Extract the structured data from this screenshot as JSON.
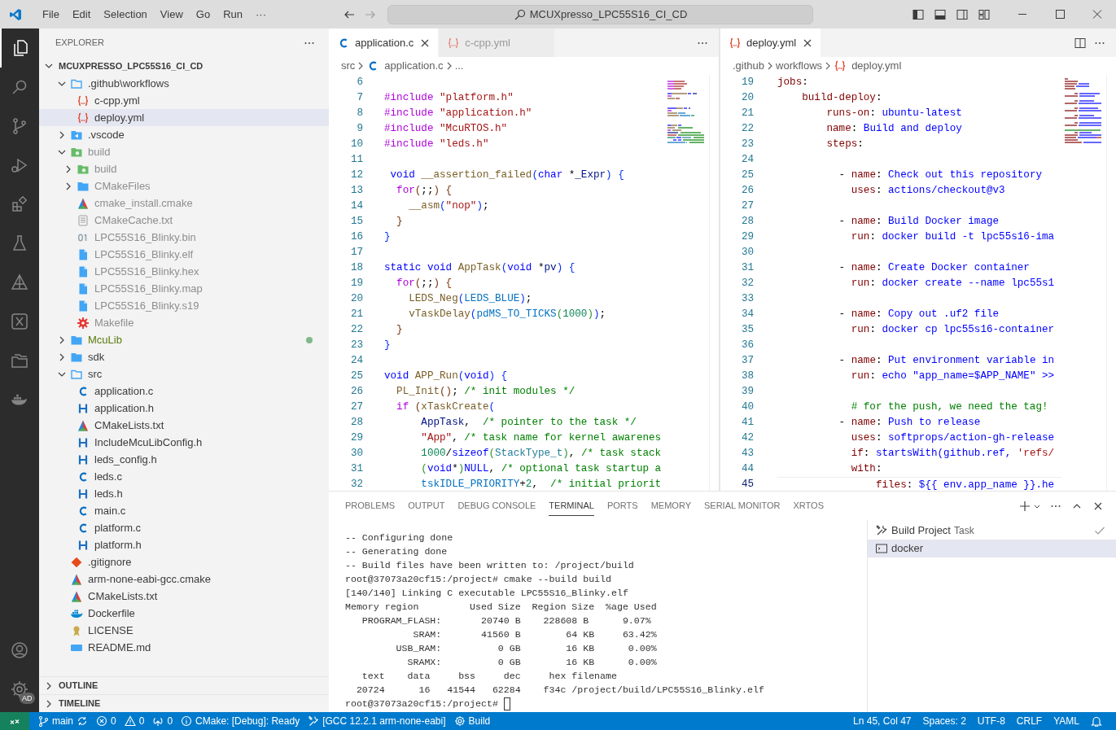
{
  "title_bar": {
    "menu": [
      "File",
      "Edit",
      "Selection",
      "View",
      "Go",
      "Run",
      "···"
    ],
    "search": "MCUXpresso_LPC55S16_CI_CD"
  },
  "activity_bar": {
    "items": [
      {
        "kind": "files",
        "selected": true
      },
      {
        "kind": "search",
        "selected": false
      },
      {
        "kind": "scm",
        "selected": false
      },
      {
        "kind": "debug",
        "selected": false
      },
      {
        "kind": "extensions",
        "selected": false
      },
      {
        "kind": "testing",
        "selected": false
      },
      {
        "kind": "triangle",
        "selected": false
      },
      {
        "kind": "xbox",
        "selected": false
      },
      {
        "kind": "folders",
        "selected": false
      },
      {
        "kind": "docker",
        "selected": false
      }
    ],
    "settings_badge": "AD"
  },
  "explorer": {
    "header": "EXPLORER",
    "root": "MCUXPRESSO_LPC55S16_CI_CD",
    "items": [
      {
        "label": ".github\\workflows",
        "kind": "folder_open",
        "expanded": true,
        "selected": false,
        "ignored": false,
        "children": [
          {
            "label": "c-cpp.yml",
            "kind": "yml",
            "selected": false,
            "ignored": false
          },
          {
            "label": "deploy.yml",
            "kind": "yml",
            "selected": true,
            "ignored": false
          }
        ]
      },
      {
        "label": ".vscode",
        "kind": "folder_vscode",
        "expanded": false,
        "selected": false,
        "ignored": false
      },
      {
        "label": "build",
        "kind": "folder_build",
        "expanded": true,
        "selected": false,
        "ignored": true,
        "children": [
          {
            "label": "build",
            "kind": "folder_build",
            "expanded": false,
            "selected": false,
            "ignored": true
          },
          {
            "label": "CMakeFiles",
            "kind": "folder",
            "expanded": false,
            "selected": false,
            "ignored": true
          },
          {
            "label": "cmake_install.cmake",
            "kind": "cmake",
            "selected": false,
            "ignored": true
          },
          {
            "label": "CMakeCache.txt",
            "kind": "txt",
            "selected": false,
            "ignored": true
          },
          {
            "label": "LPC55S16_Blinky.bin",
            "kind": "bin",
            "selected": false,
            "ignored": true
          },
          {
            "label": "LPC55S16_Blinky.elf",
            "kind": "file",
            "selected": false,
            "ignored": true
          },
          {
            "label": "LPC55S16_Blinky.hex",
            "kind": "file",
            "selected": false,
            "ignored": true
          },
          {
            "label": "LPC55S16_Blinky.map",
            "kind": "file",
            "selected": false,
            "ignored": true
          },
          {
            "label": "LPC55S16_Blinky.s19",
            "kind": "file",
            "selected": false,
            "ignored": true
          },
          {
            "label": "Makefile",
            "kind": "gear",
            "selected": false,
            "ignored": true
          }
        ]
      },
      {
        "label": "McuLib",
        "kind": "folder",
        "expanded": false,
        "selected": false,
        "ignored": false,
        "modified": true
      },
      {
        "label": "sdk",
        "kind": "folder",
        "expanded": false,
        "selected": false,
        "ignored": false
      },
      {
        "label": "src",
        "kind": "folder_open",
        "expanded": true,
        "selected": false,
        "ignored": false,
        "children": [
          {
            "label": "application.c",
            "kind": "c",
            "selected": false,
            "ignored": false
          },
          {
            "label": "application.h",
            "kind": "h",
            "selected": false,
            "ignored": false
          },
          {
            "label": "CMakeLists.txt",
            "kind": "cmake",
            "selected": false,
            "ignored": false
          },
          {
            "label": "IncludeMcuLibConfig.h",
            "kind": "h",
            "selected": false,
            "ignored": false
          },
          {
            "label": "leds_config.h",
            "kind": "h",
            "selected": false,
            "ignored": false
          },
          {
            "label": "leds.c",
            "kind": "c",
            "selected": false,
            "ignored": false
          },
          {
            "label": "leds.h",
            "kind": "h",
            "selected": false,
            "ignored": false
          },
          {
            "label": "main.c",
            "kind": "c",
            "selected": false,
            "ignored": false
          },
          {
            "label": "platform.c",
            "kind": "c",
            "selected": false,
            "ignored": false
          },
          {
            "label": "platform.h",
            "kind": "h",
            "selected": false,
            "ignored": false
          }
        ]
      },
      {
        "label": ".gitignore",
        "kind": "git",
        "selected": false,
        "ignored": false
      },
      {
        "label": "arm-none-eabi-gcc.cmake",
        "kind": "cmake",
        "selected": false,
        "ignored": false
      },
      {
        "label": "CMakeLists.txt",
        "kind": "cmake",
        "selected": false,
        "ignored": false
      },
      {
        "label": "Dockerfile",
        "kind": "docker",
        "selected": false,
        "ignored": false
      },
      {
        "label": "LICENSE",
        "kind": "license",
        "selected": false,
        "ignored": false
      },
      {
        "label": "README.md",
        "kind": "md",
        "selected": false,
        "ignored": false
      }
    ],
    "sections": [
      {
        "label": "OUTLINE",
        "expanded": false
      },
      {
        "label": "TIMELINE",
        "expanded": false
      }
    ]
  },
  "editor_groups": [
    {
      "tabs": [
        {
          "label": "application.c",
          "kind": "c",
          "selected": true
        },
        {
          "label": "c-cpp.yml",
          "kind": "yml",
          "selected": false
        }
      ],
      "breadcrumbs": [
        {
          "label": "src"
        },
        {
          "label": "application.c",
          "kind": "c"
        },
        {
          "label": "..."
        }
      ],
      "lines": [
        {
          "n": "6"
        },
        {
          "n": "7",
          "code": [
            {
              "text": "#include",
              "kind": "pp"
            },
            {
              "text": " \"platform.h\"",
              "kind": "str"
            }
          ]
        },
        {
          "n": "8",
          "code": [
            {
              "text": "#include",
              "kind": "pp"
            },
            {
              "text": " \"application.h\"",
              "kind": "str"
            }
          ]
        },
        {
          "n": "9",
          "code": [
            {
              "text": "#include",
              "kind": "pp"
            },
            {
              "text": " \"McuRTOS.h\"",
              "kind": "str"
            }
          ]
        },
        {
          "n": "10",
          "code": [
            {
              "text": "#include",
              "kind": "pp"
            },
            {
              "text": " \"leds.h\"",
              "kind": "str"
            }
          ]
        },
        {
          "n": "11"
        },
        {
          "n": "12",
          "code": [
            {
              "text": " void",
              "kind": "kw"
            },
            {
              "text": " __assertion_failed",
              "kind": "fn"
            },
            {
              "text": "(",
              "kind": "b1"
            },
            {
              "text": "char",
              "kind": "kw"
            },
            {
              "text": " *",
              "kind": "plain"
            },
            {
              "text": "_Expr",
              "kind": "var"
            },
            {
              "text": ")",
              "kind": "b1"
            },
            {
              "text": " {",
              "kind": "b1"
            }
          ]
        },
        {
          "n": "13",
          "code": [
            {
              "text": "  for",
              "kind": "ctl"
            },
            {
              "text": "(",
              "kind": "b3"
            },
            {
              "text": ";;",
              "kind": "plain"
            },
            {
              "text": ")",
              "kind": "b3"
            },
            {
              "text": " {",
              "kind": "b3"
            }
          ]
        },
        {
          "n": "14",
          "code": [
            {
              "text": "    __asm",
              "kind": "fn"
            },
            {
              "text": "(",
              "kind": "b1"
            },
            {
              "text": "\"nop\"",
              "kind": "str"
            },
            {
              "text": ")",
              "kind": "b1"
            },
            {
              "text": ";",
              "kind": "plain"
            }
          ]
        },
        {
          "n": "15",
          "code": [
            {
              "text": "  }",
              "kind": "b3"
            }
          ]
        },
        {
          "n": "16",
          "code": [
            {
              "text": "}",
              "kind": "b1"
            }
          ]
        },
        {
          "n": "17"
        },
        {
          "n": "18",
          "code": [
            {
              "text": "static",
              "kind": "kw"
            },
            {
              "text": " void",
              "kind": "kw"
            },
            {
              "text": " AppTask",
              "kind": "fn"
            },
            {
              "text": "(",
              "kind": "b1"
            },
            {
              "text": "void",
              "kind": "kw"
            },
            {
              "text": " *",
              "kind": "plain"
            },
            {
              "text": "pv",
              "kind": "var"
            },
            {
              "text": ")",
              "kind": "b1"
            },
            {
              "text": " {",
              "kind": "b1"
            }
          ]
        },
        {
          "n": "19",
          "code": [
            {
              "text": "  for",
              "kind": "ctl"
            },
            {
              "text": "(",
              "kind": "b3"
            },
            {
              "text": ";;",
              "kind": "plain"
            },
            {
              "text": ")",
              "kind": "b3"
            },
            {
              "text": " {",
              "kind": "b3"
            }
          ]
        },
        {
          "n": "20",
          "code": [
            {
              "text": "    LEDS_Neg",
              "kind": "fn"
            },
            {
              "text": "(",
              "kind": "b1"
            },
            {
              "text": "LEDS_BLUE",
              "kind": "const"
            },
            {
              "text": ")",
              "kind": "b1"
            },
            {
              "text": ";",
              "kind": "plain"
            }
          ]
        },
        {
          "n": "21",
          "code": [
            {
              "text": "    vTaskDelay",
              "kind": "fn"
            },
            {
              "text": "(",
              "kind": "b1"
            },
            {
              "text": "pdMS_TO_TICKS",
              "kind": "const"
            },
            {
              "text": "(",
              "kind": "b2"
            },
            {
              "text": "1000",
              "kind": "num"
            },
            {
              "text": ")",
              "kind": "b2"
            },
            {
              "text": ")",
              "kind": "b1"
            },
            {
              "text": ";",
              "kind": "plain"
            }
          ]
        },
        {
          "n": "22",
          "code": [
            {
              "text": "  }",
              "kind": "b3"
            }
          ]
        },
        {
          "n": "23",
          "code": [
            {
              "text": "}",
              "kind": "b1"
            }
          ]
        },
        {
          "n": "24"
        },
        {
          "n": "25",
          "code": [
            {
              "text": "void",
              "kind": "kw"
            },
            {
              "text": " APP_Run",
              "kind": "fn"
            },
            {
              "text": "(",
              "kind": "b1"
            },
            {
              "text": "void",
              "kind": "kw"
            },
            {
              "text": ")",
              "kind": "b1"
            },
            {
              "text": " {",
              "kind": "b1"
            }
          ]
        },
        {
          "n": "26",
          "code": [
            {
              "text": "  PL_Init",
              "kind": "fn"
            },
            {
              "text": "(",
              "kind": "b3"
            },
            {
              "text": ")",
              "kind": "b3"
            },
            {
              "text": "; ",
              "kind": "plain"
            },
            {
              "text": "/* init modules */",
              "kind": "cm"
            }
          ]
        },
        {
          "n": "27",
          "code": [
            {
              "text": "  if",
              "kind": "ctl"
            },
            {
              "text": " (",
              "kind": "b3"
            },
            {
              "text": "xTaskCreate",
              "kind": "fn"
            },
            {
              "text": "(",
              "kind": "b1"
            }
          ]
        },
        {
          "n": "28",
          "code": [
            {
              "text": "      AppTask",
              "kind": "var"
            },
            {
              "text": ",  ",
              "kind": "plain"
            },
            {
              "text": "/* pointer to the task */",
              "kind": "cm"
            }
          ]
        },
        {
          "n": "29",
          "code": [
            {
              "text": "      \"App\"",
              "kind": "str"
            },
            {
              "text": ", ",
              "kind": "plain"
            },
            {
              "text": "/* task name for kernel awarenes",
              "kind": "cm"
            }
          ]
        },
        {
          "n": "30",
          "code": [
            {
              "text": "      1000",
              "kind": "num"
            },
            {
              "text": "/",
              "kind": "plain"
            },
            {
              "text": "sizeof",
              "kind": "kw"
            },
            {
              "text": "(",
              "kind": "b2"
            },
            {
              "text": "StackType_t",
              "kind": "type"
            },
            {
              "text": ")",
              "kind": "b2"
            },
            {
              "text": ", ",
              "kind": "plain"
            },
            {
              "text": "/* task stack",
              "kind": "cm"
            }
          ]
        },
        {
          "n": "31",
          "code": [
            {
              "text": "      (",
              "kind": "b2"
            },
            {
              "text": "void",
              "kind": "kw"
            },
            {
              "text": "*",
              "kind": "plain"
            },
            {
              "text": ")",
              "kind": "b2"
            },
            {
              "text": "NULL",
              "kind": "kw"
            },
            {
              "text": ", ",
              "kind": "plain"
            },
            {
              "text": "/* optional task startup a",
              "kind": "cm"
            }
          ]
        },
        {
          "n": "32",
          "code": [
            {
              "text": "      tskIDLE_PRIORITY",
              "kind": "const"
            },
            {
              "text": "+",
              "kind": "plain"
            },
            {
              "text": "2",
              "kind": "num"
            },
            {
              "text": ",  ",
              "kind": "plain"
            },
            {
              "text": "/* initial priorit",
              "kind": "cm"
            }
          ]
        }
      ]
    },
    {
      "tabs": [
        {
          "label": "deploy.yml",
          "kind": "yml",
          "selected": true
        }
      ],
      "breadcrumbs": [
        {
          "label": ".github"
        },
        {
          "label": "workflows"
        },
        {
          "label": "deploy.yml",
          "kind": "yml"
        }
      ],
      "lines": [
        {
          "n": "19",
          "code": [
            {
              "text": "jobs",
              "kind": "key"
            },
            {
              "text": ":",
              "kind": "plain"
            }
          ]
        },
        {
          "n": "20",
          "code": [
            {
              "text": "    build-deploy",
              "kind": "key"
            },
            {
              "text": ":",
              "kind": "plain"
            }
          ]
        },
        {
          "n": "21",
          "code": [
            {
              "text": "        runs-on",
              "kind": "key"
            },
            {
              "text": ": ",
              "kind": "plain"
            },
            {
              "text": "ubuntu-latest",
              "kind": "val"
            }
          ]
        },
        {
          "n": "22",
          "code": [
            {
              "text": "        name",
              "kind": "key"
            },
            {
              "text": ": ",
              "kind": "plain"
            },
            {
              "text": "Build and deploy",
              "kind": "val"
            }
          ]
        },
        {
          "n": "23",
          "code": [
            {
              "text": "        steps",
              "kind": "key"
            },
            {
              "text": ":",
              "kind": "plain"
            }
          ]
        },
        {
          "n": "24"
        },
        {
          "n": "25",
          "code": [
            {
              "text": "          - ",
              "kind": "plain"
            },
            {
              "text": "name",
              "kind": "key"
            },
            {
              "text": ": ",
              "kind": "plain"
            },
            {
              "text": "Check out this repository",
              "kind": "val"
            }
          ]
        },
        {
          "n": "26",
          "code": [
            {
              "text": "            uses",
              "kind": "key"
            },
            {
              "text": ": ",
              "kind": "plain"
            },
            {
              "text": "actions/checkout@v3",
              "kind": "val"
            }
          ]
        },
        {
          "n": "27"
        },
        {
          "n": "28",
          "code": [
            {
              "text": "          - ",
              "kind": "plain"
            },
            {
              "text": "name",
              "kind": "key"
            },
            {
              "text": ": ",
              "kind": "plain"
            },
            {
              "text": "Build Docker image",
              "kind": "val"
            }
          ]
        },
        {
          "n": "29",
          "code": [
            {
              "text": "            run",
              "kind": "key"
            },
            {
              "text": ": ",
              "kind": "plain"
            },
            {
              "text": "docker build -t lpc55s16-ima",
              "kind": "val"
            }
          ]
        },
        {
          "n": "30"
        },
        {
          "n": "31",
          "code": [
            {
              "text": "          - ",
              "kind": "plain"
            },
            {
              "text": "name",
              "kind": "key"
            },
            {
              "text": ": ",
              "kind": "plain"
            },
            {
              "text": "Create Docker container",
              "kind": "val"
            }
          ]
        },
        {
          "n": "32",
          "code": [
            {
              "text": "            run",
              "kind": "key"
            },
            {
              "text": ": ",
              "kind": "plain"
            },
            {
              "text": "docker create --name lpc55s1",
              "kind": "val"
            }
          ]
        },
        {
          "n": "33"
        },
        {
          "n": "34",
          "code": [
            {
              "text": "          - ",
              "kind": "plain"
            },
            {
              "text": "name",
              "kind": "key"
            },
            {
              "text": ": ",
              "kind": "plain"
            },
            {
              "text": "Copy out .uf2 file",
              "kind": "val"
            }
          ]
        },
        {
          "n": "35",
          "code": [
            {
              "text": "            run",
              "kind": "key"
            },
            {
              "text": ": ",
              "kind": "plain"
            },
            {
              "text": "docker cp lpc55s16-container",
              "kind": "val"
            }
          ]
        },
        {
          "n": "36"
        },
        {
          "n": "37",
          "code": [
            {
              "text": "          - ",
              "kind": "plain"
            },
            {
              "text": "name",
              "kind": "key"
            },
            {
              "text": ": ",
              "kind": "plain"
            },
            {
              "text": "Put environment variable in",
              "kind": "val"
            }
          ]
        },
        {
          "n": "38",
          "code": [
            {
              "text": "            run",
              "kind": "key"
            },
            {
              "text": ": ",
              "kind": "plain"
            },
            {
              "text": "echo \"app_name=$APP_NAME\" >>",
              "kind": "val"
            }
          ]
        },
        {
          "n": "39"
        },
        {
          "n": "40",
          "code": [
            {
              "text": "            # for the push, we need the tag!",
              "kind": "cm"
            }
          ]
        },
        {
          "n": "41",
          "code": [
            {
              "text": "          - ",
              "kind": "plain"
            },
            {
              "text": "name",
              "kind": "key"
            },
            {
              "text": ": ",
              "kind": "plain"
            },
            {
              "text": "Push to release",
              "kind": "val"
            }
          ]
        },
        {
          "n": "42",
          "code": [
            {
              "text": "            uses",
              "kind": "key"
            },
            {
              "text": ": ",
              "kind": "plain"
            },
            {
              "text": "softprops/action-gh-release",
              "kind": "val"
            }
          ]
        },
        {
          "n": "43",
          "code": [
            {
              "text": "            if",
              "kind": "key"
            },
            {
              "text": ": ",
              "kind": "plain"
            },
            {
              "text": "startsWith(github.ref, ",
              "kind": "val"
            },
            {
              "text": "'refs/",
              "kind": "str"
            }
          ]
        },
        {
          "n": "44",
          "code": [
            {
              "text": "            with",
              "kind": "key"
            },
            {
              "text": ":",
              "kind": "plain"
            }
          ]
        },
        {
          "n": "45",
          "code": [
            {
              "text": "                files",
              "kind": "key"
            },
            {
              "text": ": ",
              "kind": "plain"
            },
            {
              "text": "${{ env.app_name }}.he",
              "kind": "val"
            }
          ],
          "current": true
        }
      ]
    }
  ],
  "panel": {
    "tabs": [
      {
        "label": "PROBLEMS",
        "selected": false
      },
      {
        "label": "OUTPUT",
        "selected": false
      },
      {
        "label": "DEBUG CONSOLE",
        "selected": false
      },
      {
        "label": "TERMINAL",
        "selected": true
      },
      {
        "label": "PORTS",
        "selected": false
      },
      {
        "label": "MEMORY",
        "selected": false
      },
      {
        "label": "SERIAL MONITOR",
        "selected": false
      },
      {
        "label": "XRTOS",
        "selected": false
      }
    ],
    "terminal": {
      "lines": [
        "-- Configuring done",
        "-- Generating done",
        "-- Build files have been written to: /project/build",
        "root@37073a20cf15:/project# cmake --build build",
        "[140/140] Linking C executable LPC55S16_Blinky.elf",
        "Memory region         Used Size  Region Size  %age Used",
        "   PROGRAM_FLASH:       20740 B    228608 B      9.07%",
        "            SRAM:       41560 B        64 KB     63.42%",
        "         USB_RAM:          0 GB        16 KB      0.00%",
        "           SRAMX:          0 GB        16 KB      0.00%",
        "   text    data     bss     dec     hex filename",
        "  20724      16   41544   62284    f34c /project/build/LPC55S16_Blinky.elf",
        "root@37073a20cf15:/project# "
      ],
      "cursor": true
    },
    "terminals": [
      {
        "label": "Build Project",
        "detail": "Task",
        "kind": "task",
        "done": true,
        "selected": false
      },
      {
        "label": "docker",
        "kind": "shell",
        "selected": true
      }
    ]
  },
  "status_bar": {
    "left": [
      {
        "kind": "remote"
      },
      {
        "kind": "branch",
        "text": "main"
      },
      {
        "kind": "error",
        "text": "0"
      },
      {
        "kind": "warning",
        "text": "0"
      },
      {
        "kind": "antenna",
        "text": "0"
      },
      {
        "kind": "info",
        "text": "CMake: [Debug]: Ready"
      },
      {
        "kind": "tools",
        "text": "[GCC 12.2.1 arm-none-eabi]"
      },
      {
        "kind": "gear",
        "text": "Build"
      }
    ],
    "right": [
      {
        "text": "Ln 45, Col 47"
      },
      {
        "text": "Spaces: 2"
      },
      {
        "text": "UTF-8"
      },
      {
        "text": "CRLF"
      },
      {
        "text": "YAML"
      },
      {
        "kind": "bell"
      }
    ]
  }
}
